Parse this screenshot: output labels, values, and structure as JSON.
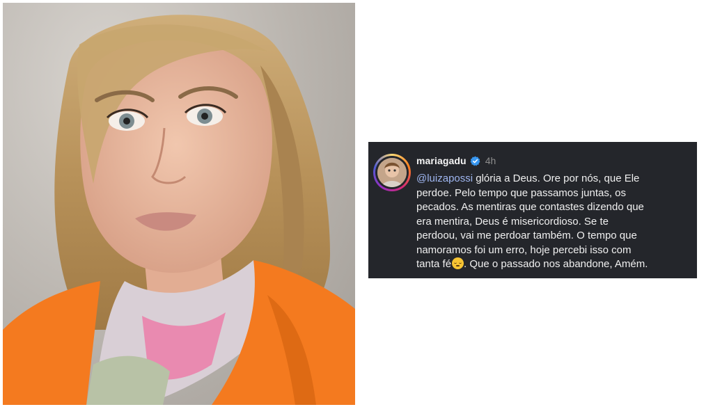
{
  "comment": {
    "username": "mariagadu",
    "verified": true,
    "time": "4h",
    "mention": "@luizapossi",
    "lines": [
      " glória a Deus.  Ore por nós, que Ele",
      "perdoe. Pelo tempo que passamos juntas, os",
      "pecados. As mentiras que contastes dizendo que",
      "era mentira, Deus é misericordioso. Se te",
      "perdoou, vai me perdoar também. O tempo que",
      "namoramos foi um erro, hoje percebi isso com"
    ],
    "last_line_before_emoji": "tanta fé",
    "emoji": "relieved-face-emoji",
    "last_line_after_emoji": ". Que o passado nos abandone,  Amém."
  },
  "colors": {
    "comment_bg": "#24262b",
    "mention": "#9fb6f0",
    "verified": "#3897f0",
    "jacket": "#f47a1f"
  },
  "icons": [
    "verified-badge-icon"
  ]
}
